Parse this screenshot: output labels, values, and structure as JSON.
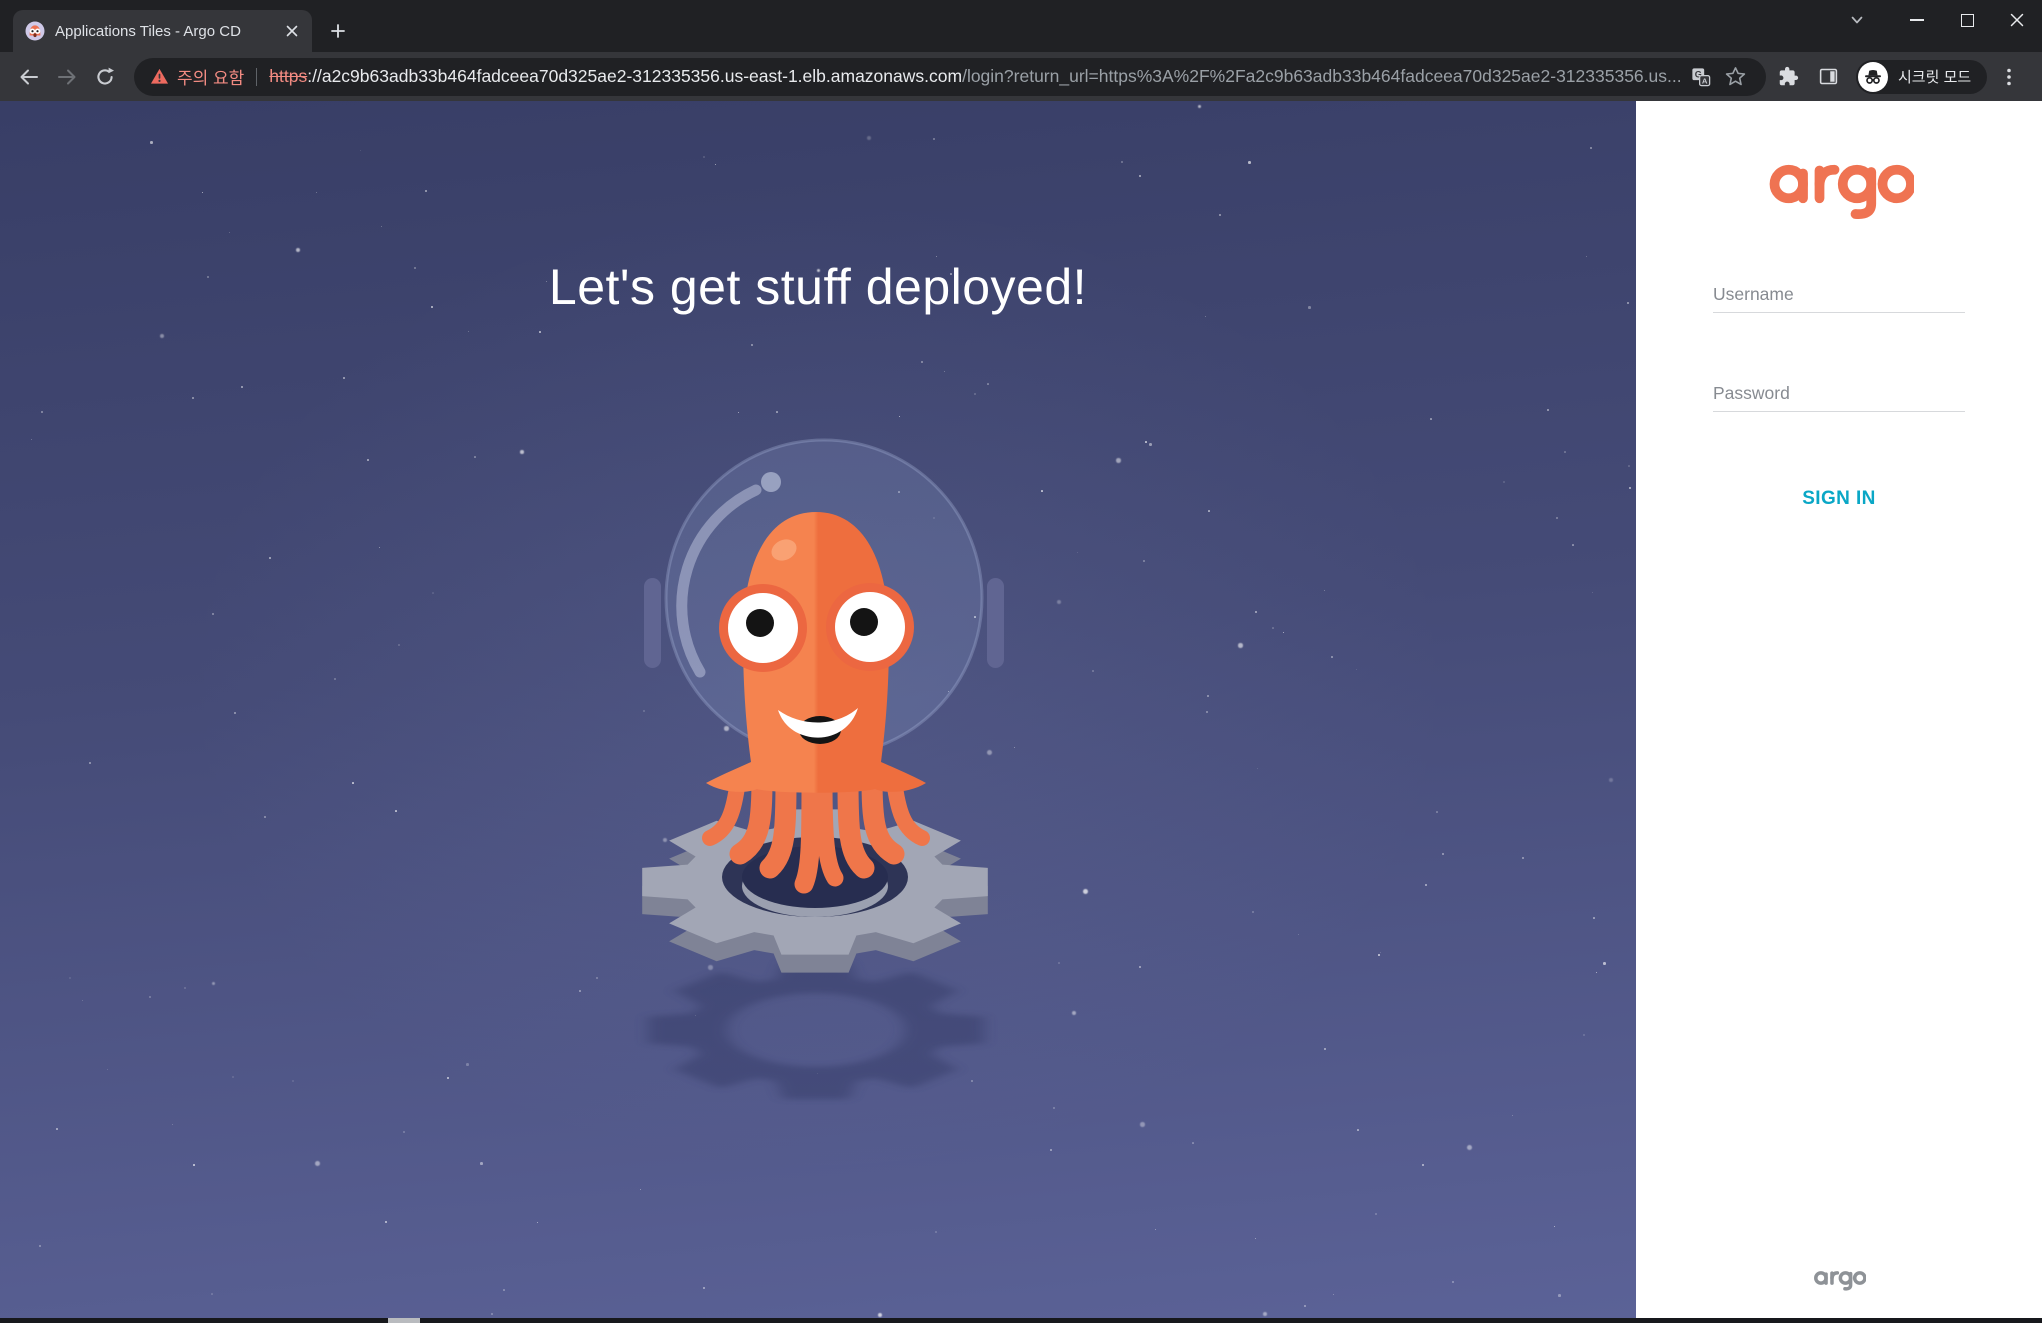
{
  "browser": {
    "tab": {
      "title": "Applications Tiles - Argo CD"
    },
    "toolbar": {
      "warning_label": "주의 요함",
      "url": {
        "scheme": "https",
        "host_sep": "://",
        "host": "a2c9b63adb33b464fadceea70d325ae2-312335356.us-east-1.elb.amazonaws.com",
        "path": "/login?return_url=https%3A%2F%2Fa2c9b63adb33b464fadceea70d325ae2-312335356.us..."
      },
      "incognito_label": "시크릿 모드"
    }
  },
  "hero": {
    "heading": "Let's get stuff deployed!"
  },
  "login": {
    "logo_text": "argo",
    "username_placeholder": "Username",
    "password_placeholder": "Password",
    "sign_in_label": "SIGN IN",
    "footer_logo_text": "argo"
  },
  "icons": {
    "tab_favicon": "argo-octopus-icon",
    "tab_close": "close-icon",
    "new_tab": "plus-icon",
    "tab_search": "chevron-down-icon",
    "window_minimize": "minimize-icon",
    "window_maximize": "maximize-icon",
    "window_close": "close-icon",
    "nav_back": "back-arrow-icon",
    "nav_forward": "forward-arrow-icon",
    "nav_reload": "reload-icon",
    "security_warning": "warning-triangle-icon",
    "translate": "translate-icon",
    "bookmark": "star-icon",
    "extensions": "puzzle-icon",
    "side_panel": "side-panel-icon",
    "incognito": "incognito-icon",
    "menu": "kebab-menu-icon"
  },
  "colors": {
    "argo_orange": "#EF7352",
    "sign_in_teal": "#0AA7C6",
    "warning_red": "#F28B82",
    "hero_top": "#383E66",
    "hero_bottom": "#5B6297",
    "chrome_dark": "#202124",
    "chrome_frame": "#35363A"
  }
}
